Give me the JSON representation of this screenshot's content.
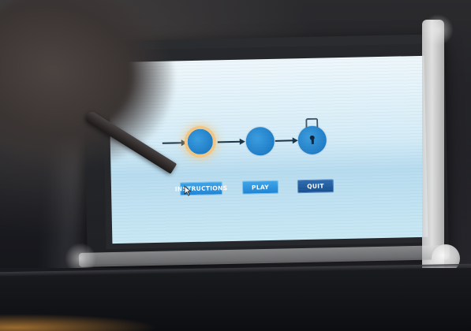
{
  "menu": {
    "buttons": [
      {
        "label": "INSTRUCTIONS",
        "highlighted": true
      },
      {
        "label": "PLAY",
        "highlighted": false
      },
      {
        "label": "QUIT",
        "highlighted": false
      }
    ]
  },
  "flow": {
    "steps": [
      "start-node-icon",
      "circle-node-icon",
      "lock-icon"
    ],
    "active_step": 0
  },
  "colors": {
    "screen_bg": "#d5ecf7",
    "node_blue": "#1f7dc6",
    "active_ring": "#f2c889",
    "button_light": "#2f95de",
    "button_dark": "#1d5a9e"
  }
}
